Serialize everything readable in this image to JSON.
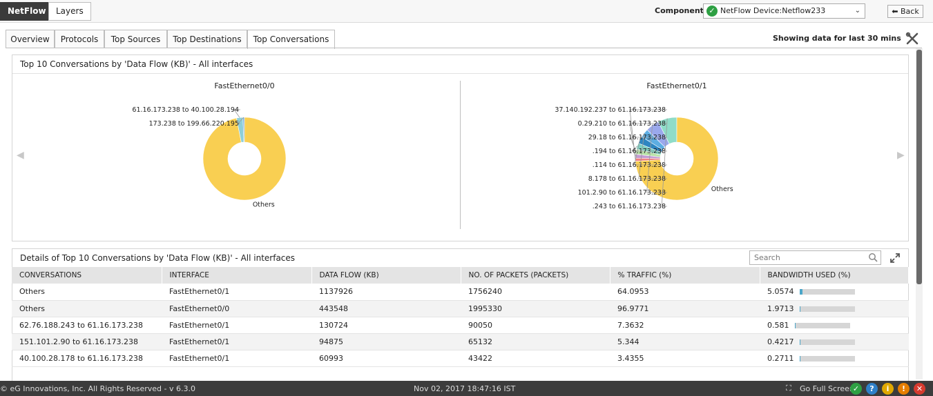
{
  "topbar": {
    "tab_active": "NetFlow",
    "tab_other": "Layers",
    "component_label": "Component",
    "component_value": "NetFlow Device:Netflow233",
    "back_label": "Back"
  },
  "tabs": [
    "Overview",
    "Protocols",
    "Top Sources",
    "Top Destinations",
    "Top Conversations"
  ],
  "selected_tab": "Top Conversations",
  "showing_text": "Showing data for last 30 mins",
  "chart_panel": {
    "title": "Top 10 Conversations by 'Data Flow (KB)' - All interfaces"
  },
  "chart_data": [
    {
      "type": "pie",
      "title": "FastEthernet0/0",
      "labels": [
        "61.16.173.238 to 40.100.28.194",
        "173.238 to 199.66.220.195",
        "Others"
      ],
      "values": [
        2.5,
        0.6,
        96.9
      ],
      "colors": [
        "#8ecfd9",
        "#6fa8dc",
        "#f9cf52"
      ]
    },
    {
      "type": "pie",
      "title": "FastEthernet0/1",
      "labels": [
        "37.140.192.237 to 61.16.173.238",
        "0.29.210 to 61.16.173.238",
        "29.18 to 61.16.173.238",
        ".194 to 61.16.173.238",
        ".114 to 61.16.173.238",
        "8.178 to 61.16.173.238",
        "101.2.90 to 61.16.173.238",
        ".243 to 61.16.173.238",
        "Others"
      ],
      "values": [
        1.2,
        1.5,
        2.0,
        2.4,
        2.8,
        3.4,
        5.3,
        7.4,
        74.0
      ],
      "colors": [
        "#f08080",
        "#c39bd3",
        "#b9e3a8",
        "#7fd0c2",
        "#2e86c1",
        "#5dade2",
        "#9aa8ec",
        "#8fdcc8",
        "#f9cf52"
      ]
    }
  ],
  "table_panel": {
    "title": "Details of Top 10 Conversations by 'Data Flow (KB)' - All interfaces",
    "search_placeholder": "Search",
    "headers": [
      "CONVERSATIONS",
      "INTERFACE",
      "DATA FLOW (KB)",
      "NO. OF PACKETS (PACKETS)",
      "% TRAFFIC (%)",
      "BANDWIDTH USED (%)"
    ],
    "rows": [
      {
        "conv": "Others",
        "iface": "FastEthernet0/1",
        "flow": "1137926",
        "packets": "1756240",
        "traffic": "64.0953",
        "bw": "5.0574",
        "bw_fraction": 0.05
      },
      {
        "conv": "Others",
        "iface": "FastEthernet0/0",
        "flow": "443548",
        "packets": "1995330",
        "traffic": "96.9771",
        "bw": "1.9713",
        "bw_fraction": 0.02
      },
      {
        "conv": "62.76.188.243 to 61.16.173.238",
        "iface": "FastEthernet0/1",
        "flow": "130724",
        "packets": "90050",
        "traffic": "7.3632",
        "bw": "0.581",
        "bw_fraction": 0.006
      },
      {
        "conv": "151.101.2.90 to 61.16.173.238",
        "iface": "FastEthernet0/1",
        "flow": "94875",
        "packets": "65132",
        "traffic": "5.344",
        "bw": "0.4217",
        "bw_fraction": 0.004
      },
      {
        "conv": "40.100.28.178 to 61.16.173.238",
        "iface": "FastEthernet0/1",
        "flow": "60993",
        "packets": "43422",
        "traffic": "3.4355",
        "bw": "0.2711",
        "bw_fraction": 0.003
      }
    ]
  },
  "footer": {
    "copyright": "© eG Innovations, Inc. All Rights Reserved - v 6.3.0",
    "datetime": "Nov 02, 2017 18:47:16 IST",
    "fullscreen": "Go Full Screen"
  },
  "colors": {
    "accent_dark": "#3b3b3b",
    "pie_others": "#f9cf52"
  }
}
